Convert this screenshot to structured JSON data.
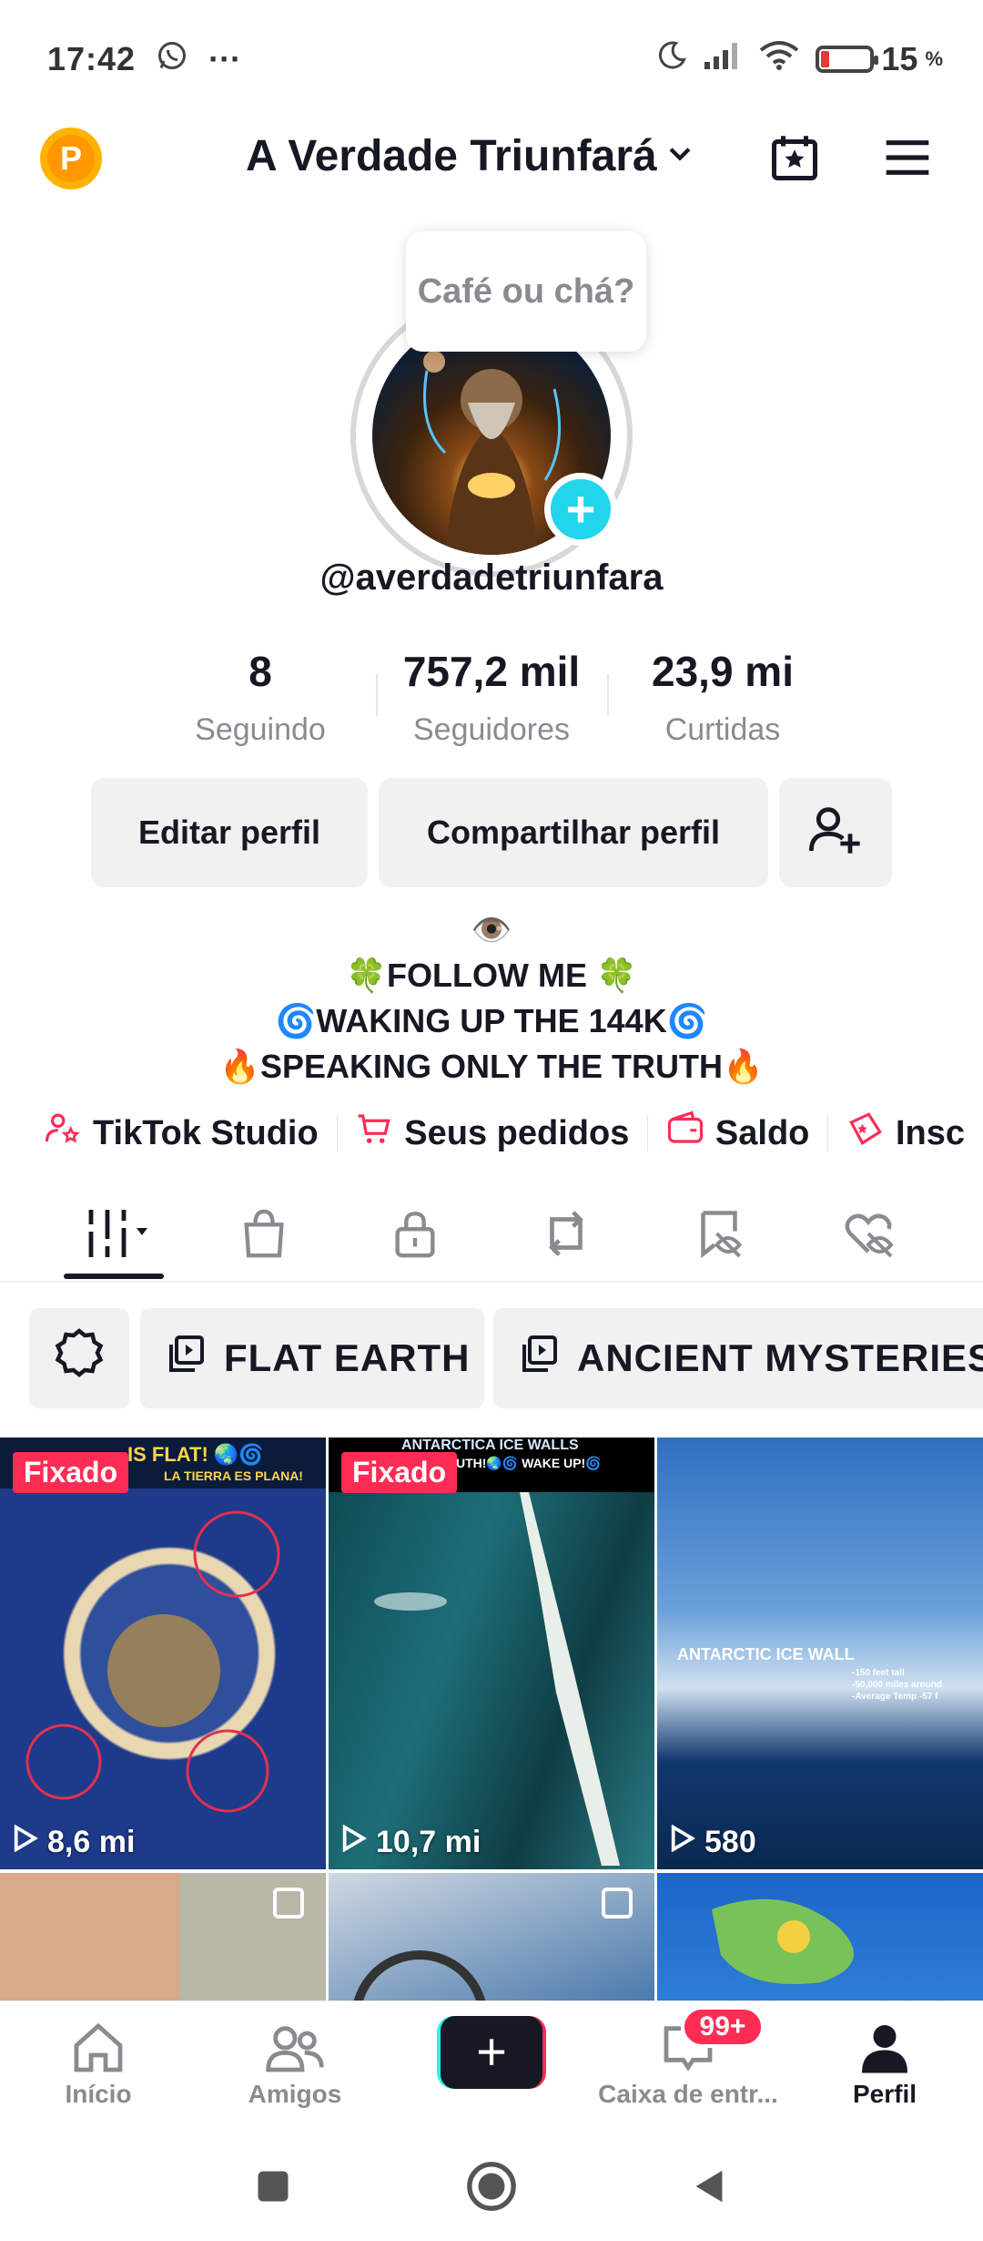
{
  "status_bar": {
    "time": "17:42",
    "battery_percent": "15",
    "battery_unit": "%",
    "icons": [
      "whatsapp-icon",
      "more-dots-icon",
      "moon-icon",
      "signal-icon",
      "wifi-icon",
      "battery-icon"
    ]
  },
  "header": {
    "badge_letter": "P",
    "title": "A Verdade Triunfará",
    "icons": [
      "chevron-down-icon",
      "calendar-star-icon",
      "menu-icon"
    ]
  },
  "profile": {
    "bubble_text": "Café ou chá?",
    "username": "@averdadetriunfara"
  },
  "stats": [
    {
      "value": "8",
      "label": "Seguindo"
    },
    {
      "value": "757,2 mil",
      "label": "Seguidores"
    },
    {
      "value": "23,9 mi",
      "label": "Curtidas"
    }
  ],
  "actions": {
    "edit_label": "Editar perfil",
    "share_label": "Compartilhar perfil"
  },
  "bio": {
    "line0": "👁️",
    "line1": "🍀FOLLOW ME 🍀",
    "line2": "🌀WAKING UP THE 144K🌀",
    "line3": "🔥SPEAKING ONLY THE TRUTH🔥"
  },
  "links": [
    {
      "label": "TikTok Studio",
      "icon": "person-star-icon"
    },
    {
      "label": "Seus pedidos",
      "icon": "cart-icon"
    },
    {
      "label": "Saldo",
      "icon": "wallet-icon"
    },
    {
      "label": "Insc",
      "icon": "ticket-icon"
    }
  ],
  "tabs": [
    "grid-icon",
    "bag-icon",
    "lock-icon",
    "repost-icon",
    "bookmark-eye-icon",
    "heart-eye-icon"
  ],
  "playlists": [
    {
      "label": "FLAT EARTH"
    },
    {
      "label": "ANCIENT MYSTERIES"
    }
  ],
  "videos": [
    {
      "views": "8,6 mi",
      "pinned": "Fixado",
      "caption": "IS FLAT! 🌏🌀",
      "subcaption": "LA TIERRA ES PLANA!"
    },
    {
      "views": "10,7 mi",
      "pinned": "Fixado",
      "caption": "ANTARCTICA ICE WALLS",
      "subcaption": "UTH!🌏🌀 WAKE UP!🌀"
    },
    {
      "views": "580",
      "caption": "ANTARCTIC ICE WALL",
      "notes": [
        "-150 feet tall",
        "-50,000 miles around",
        "-Average Temp -57 f"
      ]
    }
  ],
  "bottom_nav": [
    {
      "label": "Início",
      "icon": "home-icon"
    },
    {
      "label": "Amigos",
      "icon": "friends-icon"
    },
    {
      "label": "",
      "icon": "plus-icon"
    },
    {
      "label": "Caixa de entr...",
      "icon": "inbox-icon"
    },
    {
      "label": "Perfil",
      "icon": "profile-icon"
    }
  ],
  "inbox_badge": "99+",
  "colors": {
    "accent": "#fe2c55",
    "teal": "#20d5ec",
    "text": "#161823",
    "muted": "#8a8b91"
  }
}
